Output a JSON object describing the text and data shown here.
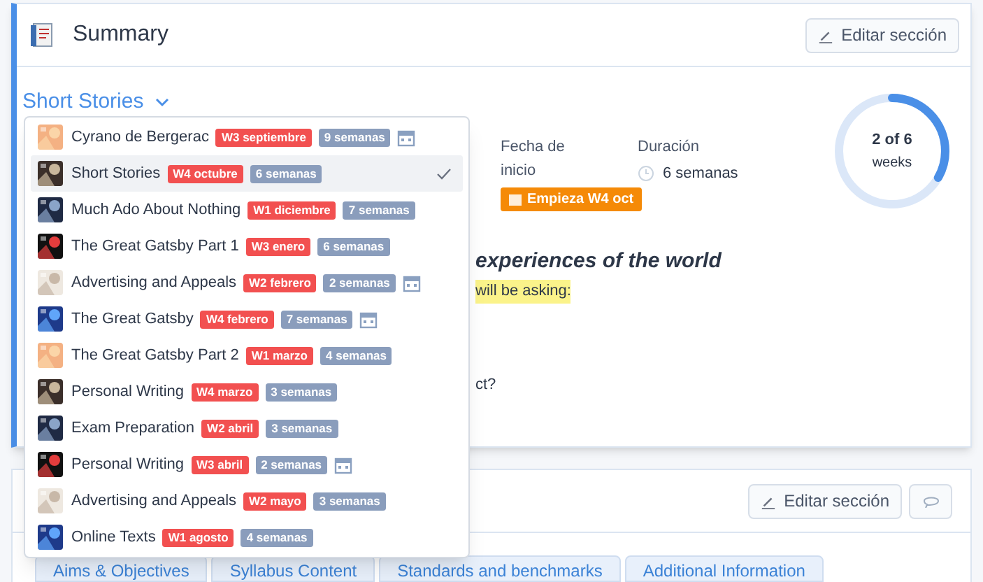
{
  "header": {
    "title": "Summary",
    "edit_button": "Editar sección"
  },
  "unit_picker": {
    "value": "Short Stories"
  },
  "start_date": {
    "label": "Fecha de inicio",
    "badge": "Empieza W4 oct"
  },
  "duration": {
    "label": "Duración",
    "value": "6 semanas"
  },
  "progress": {
    "value": "2 of 6",
    "unit": "weeks",
    "level": 0.333
  },
  "content": {
    "heading": "experiences of the world",
    "highlight": "will be asking:",
    "line": "ct?"
  },
  "menu": [
    {
      "title": "Cyrano de Bergerac",
      "start": "W3 septiembre",
      "length": "9 semanas",
      "scheduled": true,
      "selected": false
    },
    {
      "title": "Short Stories",
      "start": "W4 octubre",
      "length": "6 semanas",
      "scheduled": false,
      "selected": true
    },
    {
      "title": "Much Ado About Nothing",
      "start": "W1 diciembre",
      "length": "7 semanas",
      "scheduled": false,
      "selected": false
    },
    {
      "title": "The Great Gatsby Part 1",
      "start": "W3 enero",
      "length": "6 semanas",
      "scheduled": false,
      "selected": false
    },
    {
      "title": "Advertising and Appeals",
      "start": "W2 febrero",
      "length": "2 semanas",
      "scheduled": true,
      "selected": false
    },
    {
      "title": "The Great Gatsby",
      "start": "W4 febrero",
      "length": "7 semanas",
      "scheduled": true,
      "selected": false
    },
    {
      "title": "The Great Gatsby Part 2",
      "start": "W1 marzo",
      "length": "4 semanas",
      "scheduled": false,
      "selected": false
    },
    {
      "title": "Personal Writing",
      "start": "W4 marzo",
      "length": "3 semanas",
      "scheduled": false,
      "selected": false
    },
    {
      "title": "Exam Preparation",
      "start": "W2 abril",
      "length": "3 semanas",
      "scheduled": false,
      "selected": false
    },
    {
      "title": "Personal Writing",
      "start": "W3 abril",
      "length": "2 semanas",
      "scheduled": true,
      "selected": false
    },
    {
      "title": "Advertising and Appeals",
      "start": "W2 mayo",
      "length": "3 semanas",
      "scheduled": false,
      "selected": false
    },
    {
      "title": "Online Texts",
      "start": "W1 agosto",
      "length": "4 semanas",
      "scheduled": false,
      "selected": false
    }
  ],
  "second_section": {
    "edit_button": "Editar sección",
    "tabs": [
      {
        "label": "Aims & Objectives"
      },
      {
        "label": "Syllabus Content"
      },
      {
        "label": "Standards and benchmarks"
      },
      {
        "label": "Additional Information"
      }
    ]
  }
}
